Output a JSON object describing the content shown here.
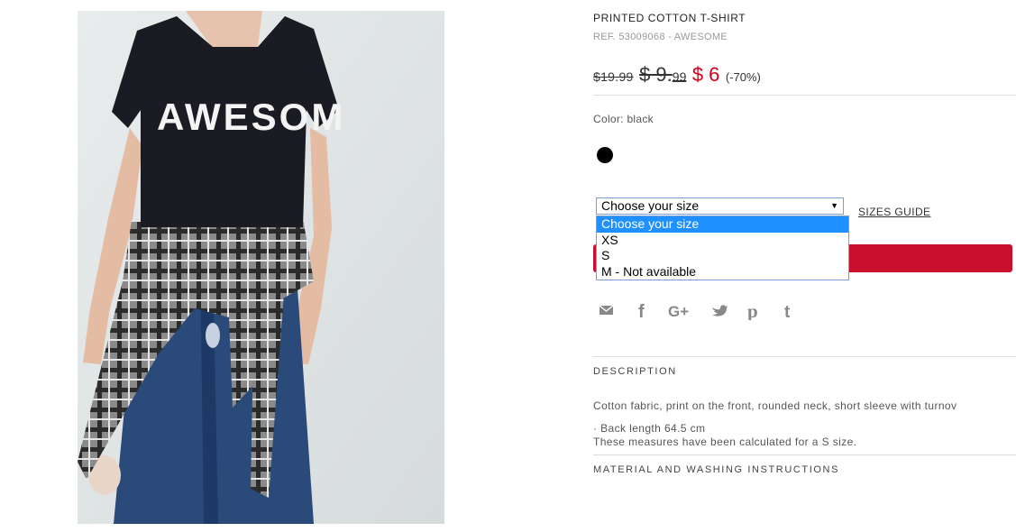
{
  "product": {
    "title": "PRINTED COTTON T-SHIRT",
    "ref": "REF. 53009068 - AWESOME",
    "photo_text": "AWESOM"
  },
  "prices": {
    "original": "$19.99",
    "previous_main": "$ 9.",
    "previous_cents": "99",
    "current": "$ 6",
    "discount": "(-70%)"
  },
  "color": {
    "label": "Color: black",
    "swatch_color": "#000000"
  },
  "size": {
    "selected": "Choose your size",
    "options": [
      "Choose your size",
      "XS",
      "S",
      "M - Not available"
    ],
    "guide_label": "SIZES GUIDE"
  },
  "add_button_color": "#c8102e",
  "share_icons": [
    "email-icon",
    "facebook-icon",
    "google-plus-icon",
    "twitter-icon",
    "pinterest-icon",
    "tumblr-icon"
  ],
  "description": {
    "title": "DESCRIPTION",
    "text": "Cotton fabric, print on the front, rounded neck, short sleeve with turnov",
    "back_length": "· Back length 64.5 cm",
    "measure_note": "These measures have been calculated for a S size."
  },
  "material": {
    "title": "MATERIAL AND WASHING INSTRUCTIONS"
  }
}
